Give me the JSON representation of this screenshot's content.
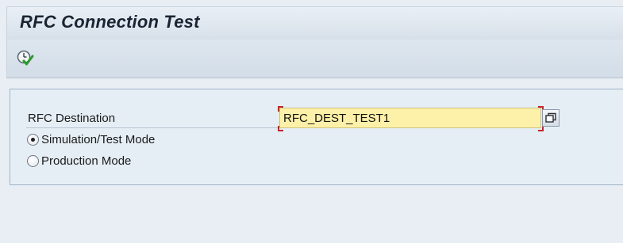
{
  "screen": {
    "title": "RFC Connection Test"
  },
  "toolbar": {
    "execute_icon": "execute-clock-check-icon"
  },
  "form": {
    "rfc_destination_label": "RFC Destination",
    "rfc_destination_value": "RFC_DEST_TEST1",
    "value_help_icon": "value-help-icon",
    "mode_options": [
      {
        "label": "Simulation/Test Mode",
        "selected": true
      },
      {
        "label": "Production Mode",
        "selected": false
      }
    ]
  },
  "colors": {
    "input_background": "#fdf0a8",
    "required_marker": "#c8242a",
    "title_text": "#1a2533"
  }
}
